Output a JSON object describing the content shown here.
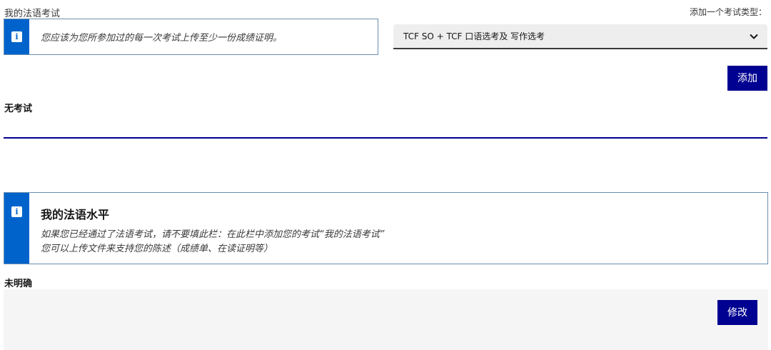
{
  "header": {
    "section_title": "我的法语考试",
    "add_type_label": "添加一个考试类型："
  },
  "info_top": {
    "icon": "info-icon",
    "text": "您应该为您所参加过的每一次考试上传至少一份成绩证明。"
  },
  "exam_select": {
    "selected": "TCF SO + TCF 口语选考及 写作选考",
    "icon": "chevron-down-icon"
  },
  "buttons": {
    "add_label": "添加",
    "edit_label": "修改"
  },
  "exams": {
    "empty_label": "无考试"
  },
  "level_info": {
    "icon": "info-icon",
    "heading": "我的法语水平",
    "line1": "如果您已经通过了法语考试，请不要填此栏：在此栏中添加您的考试“我的法语考试”",
    "line2": "您可以上传文件来支持您的陈述（成绩单、在读证明等）"
  },
  "level": {
    "value_label": "未明确"
  },
  "colors": {
    "primary": "#000091",
    "info": "#0063cb",
    "info_border": "#6a8faf",
    "panel": "#f5f5f5"
  }
}
